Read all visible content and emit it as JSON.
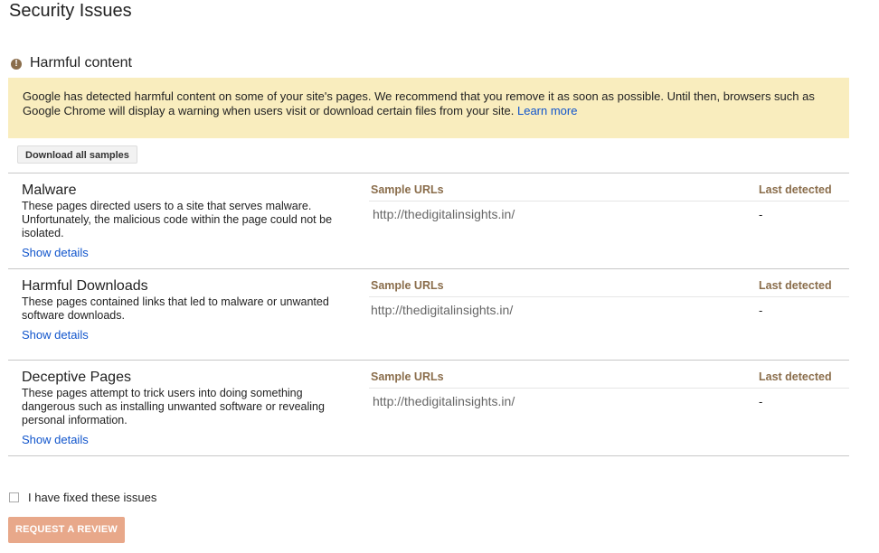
{
  "page": {
    "title": "Security Issues"
  },
  "section": {
    "icon": "alert-circle-icon",
    "title": "Harmful content"
  },
  "alert": {
    "text": "Google has detected harmful content on some of your site's pages. We recommend that you remove it as soon as possible. Until then, browsers such as Google Chrome will display a warning when users visit or download certain files from your site.",
    "link": "Learn more"
  },
  "download_button": "Download all samples",
  "issues": [
    {
      "title": "Malware",
      "description": "These pages directed users to a site that serves malware. Unfortunately, the malicious code within the page could not be isolated.",
      "show_details": "Show details",
      "col_urls": "Sample URLs",
      "col_detected": "Last detected",
      "url": "http://thedigitalinsights.in/",
      "detected": "-"
    },
    {
      "title": "Harmful Downloads",
      "description": "These pages contained links that led to malware or unwanted software downloads.",
      "show_details": "Show details",
      "col_urls": "Sample URLs",
      "col_detected": "Last detected",
      "url": "http://thedigitalinsights.in/",
      "detected": "-"
    },
    {
      "title": "Deceptive Pages",
      "description": "These pages attempt to trick users into doing something dangerous such as installing unwanted software or revealing personal information.",
      "show_details": "Show details",
      "col_urls": "Sample URLs",
      "col_detected": "Last detected",
      "url": "http://thedigitalinsights.in/",
      "detected": "-"
    }
  ],
  "fixed_checkbox": {
    "label": "I have fixed these issues",
    "checked": false
  },
  "review_button": "REQUEST A REVIEW",
  "colors": {
    "link": "#1155cc",
    "alert_bg": "#f9edbe",
    "header_brown": "#8a6d4b",
    "review_button": "#e8a88a"
  }
}
